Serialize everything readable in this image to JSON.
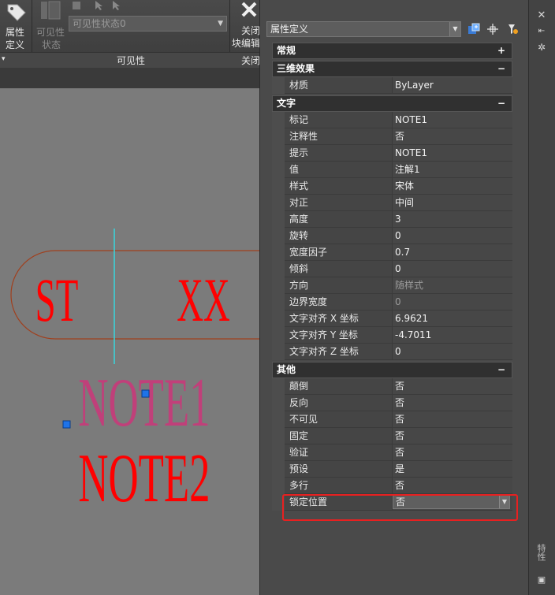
{
  "ribbon": {
    "attr_def_label_line1": "属性",
    "attr_def_label_line2": "定义",
    "visibility_state_line1": "可见性",
    "visibility_state_line2": "状态",
    "visibility_combo_value": "可见性状态0",
    "visibility_panel_label": "可见性",
    "close_label_line1": "关闭",
    "close_label_line2": "块编辑",
    "close_panel_label": "关闭"
  },
  "drawing": {
    "texts": [
      "ST",
      "XX",
      "NOTE1",
      "NOTE2"
    ],
    "colors": {
      "red_text": "#ff0000",
      "note1_text": "#c0407a",
      "crosshair": "#38d8e0",
      "outline": "#a0401e",
      "grip": "#1e73e8"
    }
  },
  "palette": {
    "type_combo_value": "属性定义",
    "side_title": "特性",
    "categories": [
      {
        "name": "常规",
        "symbol": "+",
        "rows": []
      },
      {
        "name": "三维效果",
        "symbol": "−",
        "rows": [
          {
            "name": "材质",
            "value": "ByLayer"
          }
        ]
      },
      {
        "name": "文字",
        "symbol": "−",
        "rows": [
          {
            "name": "标记",
            "value": "NOTE1"
          },
          {
            "name": "注释性",
            "value": "否"
          },
          {
            "name": "提示",
            "value": "NOTE1"
          },
          {
            "name": "值",
            "value": "注解1"
          },
          {
            "name": "样式",
            "value": "宋体"
          },
          {
            "name": "对正",
            "value": "中间"
          },
          {
            "name": "高度",
            "value": "3"
          },
          {
            "name": "旋转",
            "value": "0"
          },
          {
            "name": "宽度因子",
            "value": "0.7"
          },
          {
            "name": "倾斜",
            "value": "0"
          },
          {
            "name": "方向",
            "value": "随样式",
            "dim": true
          },
          {
            "name": "边界宽度",
            "value": "0",
            "dim": true
          },
          {
            "name": "文字对齐 X 坐标",
            "value": "6.9621"
          },
          {
            "name": "文字对齐 Y 坐标",
            "value": "-4.7011"
          },
          {
            "name": "文字对齐 Z 坐标",
            "value": "0"
          }
        ]
      },
      {
        "name": "其他",
        "symbol": "−",
        "rows": [
          {
            "name": "颠倒",
            "value": "否"
          },
          {
            "name": "反向",
            "value": "否"
          },
          {
            "name": "不可见",
            "value": "否"
          },
          {
            "name": "固定",
            "value": "否"
          },
          {
            "name": "验证",
            "value": "否"
          },
          {
            "name": "预设",
            "value": "是"
          },
          {
            "name": "多行",
            "value": "否"
          },
          {
            "name": "锁定位置",
            "value": "否",
            "dropdown": true
          }
        ]
      }
    ],
    "highlight_color": "#e82020"
  }
}
